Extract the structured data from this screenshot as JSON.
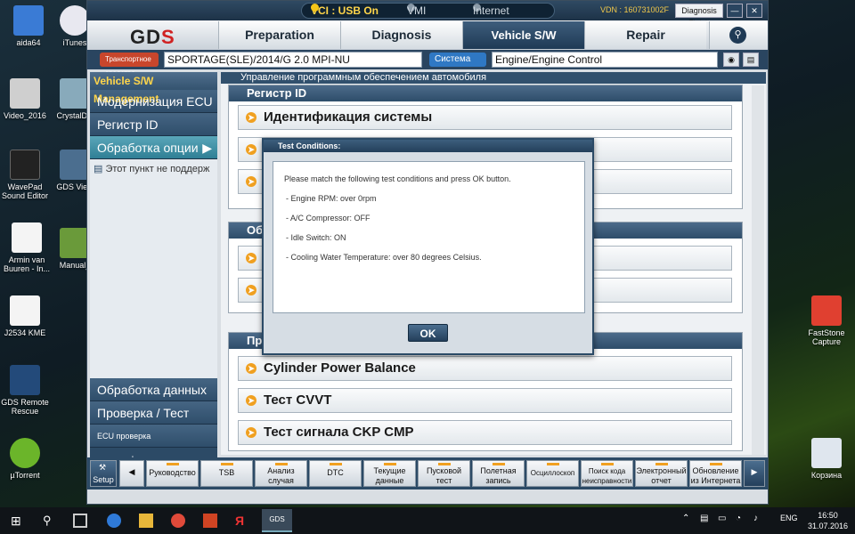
{
  "desktop": {
    "left_icons": [
      "aida64",
      "iTunes",
      "Video_2016",
      "CrystalDis",
      "WavePad Sound Editor",
      "GDS View",
      "Armin van Buuren - In...",
      "Manual_",
      "J2534 KME",
      "GDS Remote Rescue",
      "µTorrent"
    ],
    "right_icons": [
      "FastStone Capture",
      "Корзина"
    ]
  },
  "app": {
    "status": {
      "vci": "VCI : USB On",
      "vmi": "VMI : Off",
      "internet": "Internet : Off"
    },
    "vdn": "VDN : 160731002F",
    "diagnosis_finish": "Diagnosis Finish",
    "minimize": "—",
    "close": "✕",
    "logo_a": "GD",
    "logo_b": "S",
    "tabs": [
      "Preparation",
      "Diagnosis",
      "Vehicle S/W Management",
      "Repair"
    ],
    "vehicle_tag": "Транспортное средство",
    "vehicle": "SPORTAGE(SLE)/2014/G 2.0 MPI-NU",
    "system_tag": "Система",
    "system": "Engine/Engine Control"
  },
  "sidebar": {
    "header": "Vehicle S/W Management",
    "items": [
      "Модернизация ECU",
      "Регистр ID",
      "Обработка опции"
    ],
    "sub_item": "Этот пункт не поддерж",
    "bottom_items": [
      "Обработка данных",
      "Проверка / Тест",
      "ECU проверка картографирования"
    ]
  },
  "main": {
    "breadcrumb": "Управление программным обеспечением автомобиля",
    "sections": [
      {
        "title": "Регистр ID",
        "rows": [
          "Идентификация системы",
          "",
          ""
        ]
      },
      {
        "title": "Об",
        "rows": [
          "",
          ""
        ]
      },
      {
        "title": "Пр",
        "rows": [
          "Cylinder Power Balance",
          "Тест CVVT",
          "Тест сигнала CKP CMP"
        ]
      }
    ]
  },
  "dialog": {
    "title": "Test Conditions:",
    "lines": [
      "Please match the following test conditions and press OK button.",
      "- Engine RPM: over 0rpm",
      "- A/C Compressor: OFF",
      "- Idle Switch: ON",
      "- Cooling Water Temperature: over 80 degrees Celsius."
    ],
    "ok": "OK"
  },
  "toolbar": {
    "setup": "Setup",
    "tools": [
      "Руководство",
      "TSB",
      "Анализ случая",
      "DTC",
      "Текущие данные",
      "Пусковой тест",
      "Полетная запись",
      "Осциллоскоп",
      "Поиск кода неисправности",
      "Электронный отчет",
      "Обновление из Интернета"
    ]
  },
  "taskbar": {
    "lang": "ENG",
    "time": "16:50",
    "date": "31.07.2016",
    "active": "GDS"
  }
}
